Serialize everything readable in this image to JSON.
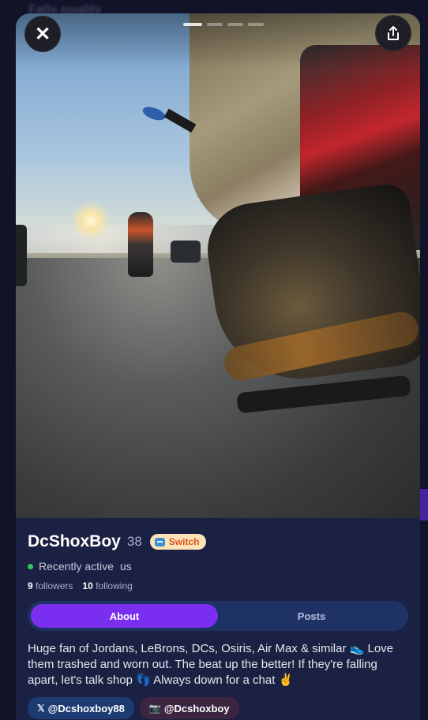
{
  "backdrop": {
    "title": "Falls quality"
  },
  "photo_viewer": {
    "alt": "Close-up of a worn sneaker on a motorcycle foot peg with a rider ahead on the road at sunset",
    "page_count": 4,
    "active_page": 1
  },
  "actions": {
    "close_glyph": "✕",
    "share_icon": "share-icon"
  },
  "profile": {
    "name": "DcShoxBoy",
    "age": "38",
    "badge": "Switch",
    "status": "Recently active",
    "country": "us",
    "followers_count": "9",
    "followers_label": "followers",
    "following_count": "10",
    "following_label": "following",
    "bio": "Huge fan of Jordans, LeBrons, DCs, Osiris, Air Max & similar 👟 Love them trashed and worn out. The beat up the better! If they're falling apart, let's talk shop 👣 Always down for a chat ✌"
  },
  "tabs": [
    {
      "label": "About",
      "active": true
    },
    {
      "label": "Posts",
      "active": false
    }
  ],
  "socials": [
    {
      "icon": "𝕏",
      "handle": "@Dcshoxboy88"
    },
    {
      "icon": "📷",
      "handle": "@Dcshoxboy"
    }
  ],
  "colors": {
    "accent": "#7a2ff0",
    "card": "#1b2142",
    "online": "#34c759",
    "badge_bg": "#fde2b8",
    "badge_text": "#d4551c"
  }
}
